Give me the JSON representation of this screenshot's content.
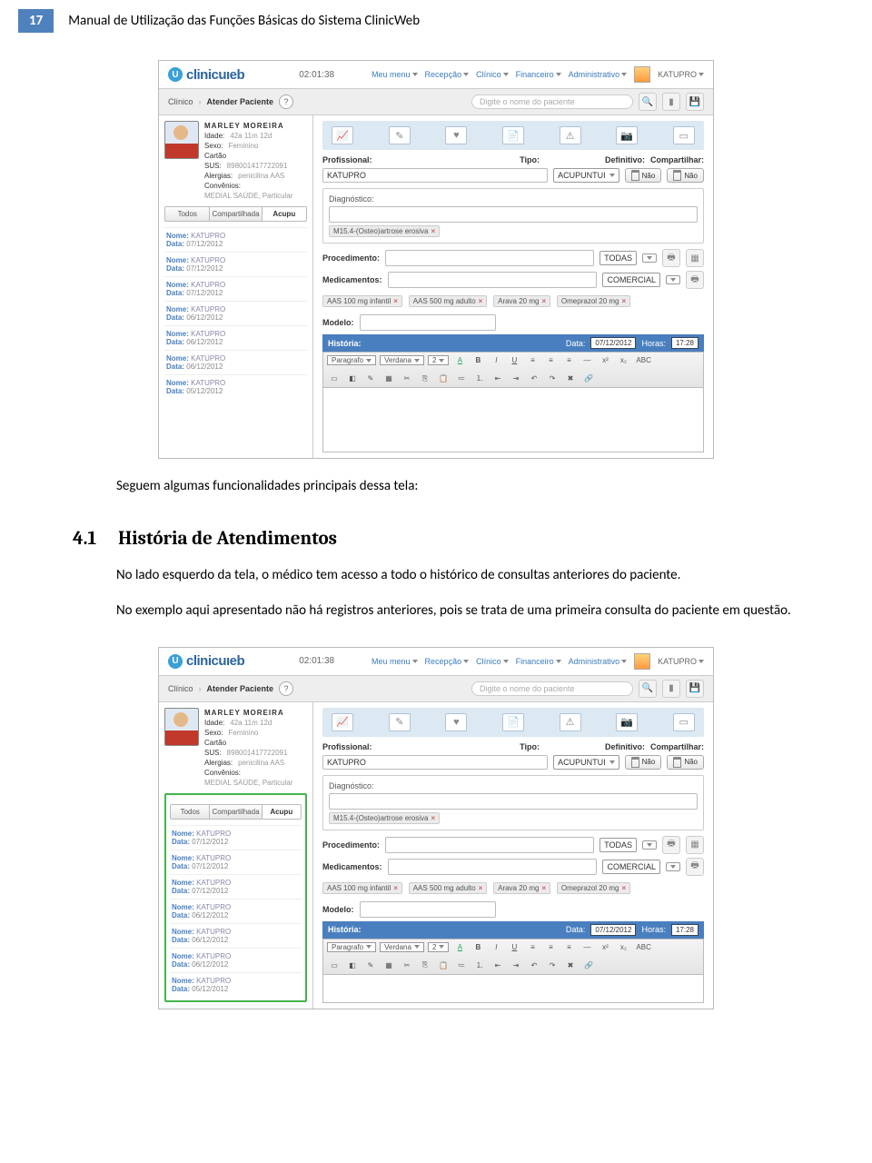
{
  "header": {
    "page_number": "17",
    "manual_title": "Manual de Utilização das Funções Básicas do Sistema ClinicWeb"
  },
  "intro": {
    "caption": "Seguem algumas funcionalidades principais dessa tela:"
  },
  "section": {
    "num": "4.1",
    "title": "História de Atendimentos",
    "p1": "No lado esquerdo da tela, o médico tem acesso a todo o histórico de consultas anteriores do paciente.",
    "p2": "No exemplo aqui apresentado não há registros anteriores, pois se trata de uma primeira consulta do paciente em questão."
  },
  "ss": {
    "logo_text": "clinicuıeb",
    "timer": "02:01:38",
    "nav": {
      "meu": "Meu menu",
      "rec": "Recepção",
      "cli": "Clínico",
      "fin": "Financeiro",
      "adm": "Administrativo",
      "user": "KATUPRO"
    },
    "crumb1": "Clínico",
    "crumb2": "Atender Paciente",
    "search_placeholder": "Digite o nome do paciente",
    "patient": {
      "name": "MARLEY MOREIRA",
      "idade_k": "Idade:",
      "idade_v": "42a 11m 12d",
      "sexo_k": "Sexo:",
      "sexo_v": "Feminino",
      "sus_k": "Cartão SUS:",
      "sus_v": "898001417722091",
      "alergias_k": "Alergias:",
      "alergias_v": "penicilina AAS",
      "conv_k": "Convênios:",
      "conv_v": "MEDIAL SAÚDE, Particular"
    },
    "tabs": {
      "t1": "Todos",
      "t2": "Compartilhada",
      "t3": "Acupu"
    },
    "history": [
      {
        "nome": "KATUPRO",
        "data": "07/12/2012"
      },
      {
        "nome": "KATUPRO",
        "data": "07/12/2012"
      },
      {
        "nome": "KATUPRO",
        "data": "07/12/2012"
      },
      {
        "nome": "KATUPRO",
        "data": "06/12/2012"
      },
      {
        "nome": "KATUPRO",
        "data": "06/12/2012"
      },
      {
        "nome": "KATUPRO",
        "data": "06/12/2012"
      },
      {
        "nome": "KATUPRO",
        "data": "05/12/2012"
      }
    ],
    "hist_label_nome": "Nome:",
    "hist_label_data": "Data:",
    "labels": {
      "profissional": "Profissional:",
      "tipo": "Tipo:",
      "definitivo": "Definitivo:",
      "compart": "Compartilhar:",
      "diagnostico": "Diagnóstico:",
      "procedimento": "Procedimento:",
      "medicamentos": "Medicamentos:",
      "modelo": "Modelo:",
      "historia": "História:",
      "data": "Data:",
      "horas": "Horas:",
      "nao": "Não"
    },
    "values": {
      "profissional": "KATUPRO",
      "tipo": "ACUPUNTUI",
      "diag_tag": "M15.4-(Osteo)artrose erosiva",
      "proc_sel": "TODAS",
      "med_sel": "COMERCIAL",
      "med1": "AAS 100 mg infantil",
      "med2": "AAS 500 mg adulto",
      "med3": "Arava 20 mg",
      "med4": "Omeprazol 20 mg",
      "hist_data": "07/12/2012",
      "hist_hora": "17:28",
      "ed_para": "Paragrafo",
      "ed_font": "Verdana",
      "ed_size": "2"
    }
  }
}
